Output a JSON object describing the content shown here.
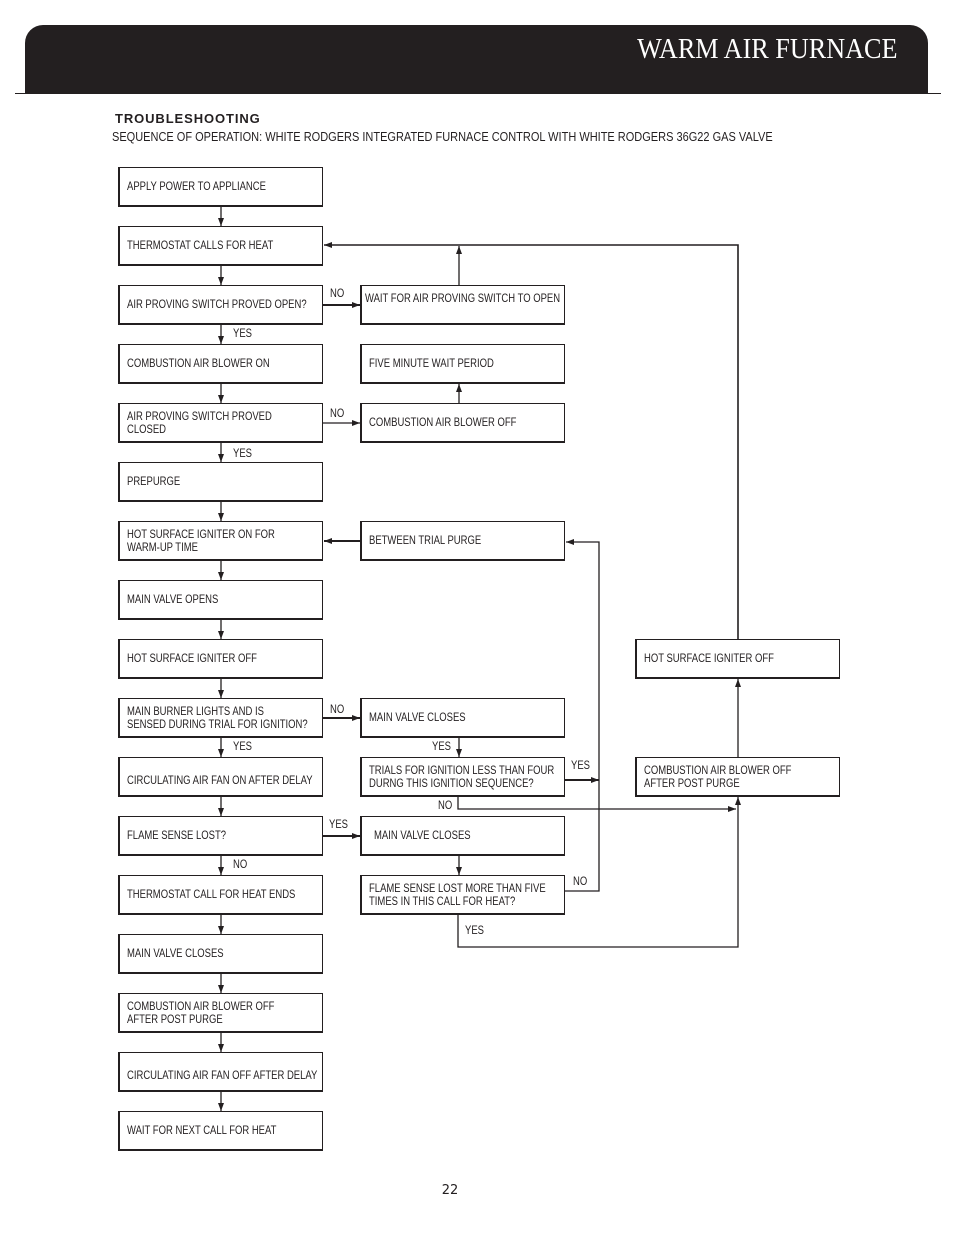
{
  "header": {
    "title": "WARM AIR FURNACE"
  },
  "section": {
    "heading": "TROUBLESHOOTING",
    "subtitle": "SEQUENCE OF OPERATION: WHITE RODGERS INTEGRATED FURNACE CONTROL WITH WHITE RODGERS 36G22 GAS VALVE"
  },
  "flowchart": {
    "main_sequence": [
      "APPLY POWER TO APPLIANCE",
      "THERMOSTAT CALLS FOR HEAT",
      "AIR PROVING SWITCH PROVED OPEN?",
      "COMBUSTION AIR BLOWER ON",
      "AIR PROVING SWITCH PROVED\nCLOSED",
      "PREPURGE",
      "HOT SURFACE IGNITER ON FOR\nWARM-UP TIME",
      "MAIN VALVE OPENS",
      "HOT SURFACE IGNITER OFF",
      "MAIN BURNER LIGHTS AND IS\nSENSED DURING TRIAL FOR IGNITION?",
      "CIRCULATING AIR FAN ON AFTER DELAY",
      "FLAME SENSE LOST?",
      "THERMOSTAT CALL FOR HEAT ENDS",
      "MAIN VALVE CLOSES",
      "COMBUSTION AIR BLOWER OFF\nAFTER POST PURGE",
      "CIRCULATING AIR FAN OFF AFTER DELAY",
      "WAIT FOR NEXT CALL FOR HEAT"
    ],
    "branches": {
      "wait_air_switch_open": "WAIT FOR AIR PROVING SWITCH TO OPEN",
      "five_minute_wait": "FIVE MINUTE WAIT PERIOD",
      "blower_off": "COMBUSTION AIR BLOWER OFF",
      "between_trial_purge": "BETWEEN TRIAL PURGE",
      "valve_closes_no_ignition": "MAIN VALVE CLOSES",
      "trials_less_than_four": "TRIALS FOR IGNITION LESS THAN FOUR\nDURNG THIS IGNITION SEQUENCE?",
      "valve_closes_flame_lost": "MAIN VALVE CLOSES",
      "flame_lost_more_than_five": "FLAME SENSE LOST MORE THAN FIVE\nTIMES IN THIS CALL FOR HEAT?",
      "lockout_igniter_off": "HOT SURFACE IGNITER OFF",
      "lockout_blower_off_post_purge": "COMBUSTION AIR BLOWER OFF\nAFTER POST PURGE"
    },
    "connector_labels": {
      "air_open_no": "NO",
      "air_open_yes": "YES",
      "air_closed_no": "NO",
      "air_closed_yes": "YES",
      "ignition_no": "NO",
      "ignition_yes": "YES",
      "valve_closes_yes": "YES",
      "trials_yes": "YES",
      "trials_no": "NO",
      "flame_lost_yes": "YES",
      "flame_lost_no": "NO",
      "five_times_no": "NO",
      "five_times_yes": "YES"
    }
  },
  "page_number": "22"
}
